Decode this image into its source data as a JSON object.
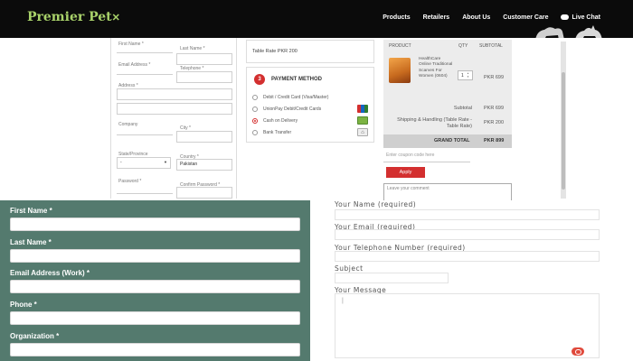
{
  "header": {
    "logo": "Premier Pet",
    "logo_mark": "✕",
    "nav": [
      "Products",
      "Retailers",
      "About Us",
      "Customer Care",
      "Live Chat"
    ]
  },
  "billing": {
    "first_name": "First Name *",
    "last_name": "Last Name *",
    "email": "Email Address *",
    "telephone": "Telephone *",
    "address": "Address *",
    "company": "Company",
    "city": "City *",
    "state": "State/Province",
    "state_value": "-",
    "country": "Country *",
    "country_value": "Pakistan",
    "password": "Password *",
    "confirm_password": "Confirm Password *"
  },
  "shipping": {
    "table_rate": "Table Rate PKR 200"
  },
  "payment": {
    "step": "3",
    "title": "PAYMENT METHOD",
    "options": [
      "Debit / Credit Card (Visa/Master)",
      "UnionPay Debit/Credit Cards",
      "Cash on Delivery",
      "Bank Transfer"
    ],
    "selected": "Cash on Delivery"
  },
  "cart": {
    "headers": [
      "PRODUCT",
      "QTY",
      "SUBTOTAL"
    ],
    "product_name": "HealthCare Online Traditional Scarves For Women (0604)",
    "qty": "1",
    "price": "PKR 699",
    "subtotal_label": "Subtotal",
    "subtotal_value": "PKR 699",
    "shipping_label": "Shipping & Handling (Table Rate - Table Rate)",
    "shipping_value": "PKR 200",
    "grand_label": "GRAND TOTAL",
    "grand_value": "PKR 899",
    "coupon_placeholder": "Enter coupon code here",
    "apply": "Apply",
    "comment_placeholder": "Leave your comment"
  },
  "lead_form": {
    "first_name": "First Name *",
    "last_name": "Last Name *",
    "email": "Email Address (Work) *",
    "phone": "Phone *",
    "organization": "Organization *"
  },
  "contact_form": {
    "name": "Your Name (required)",
    "email": "Your Email (required)",
    "telephone": "Your Telephone Number (required)",
    "subject": "Subject",
    "message": "Your Message",
    "caret": "|"
  },
  "colors": {
    "accent": "#d32f2f",
    "lead_bg": "#547a6e",
    "logo": "#a9d26a"
  }
}
